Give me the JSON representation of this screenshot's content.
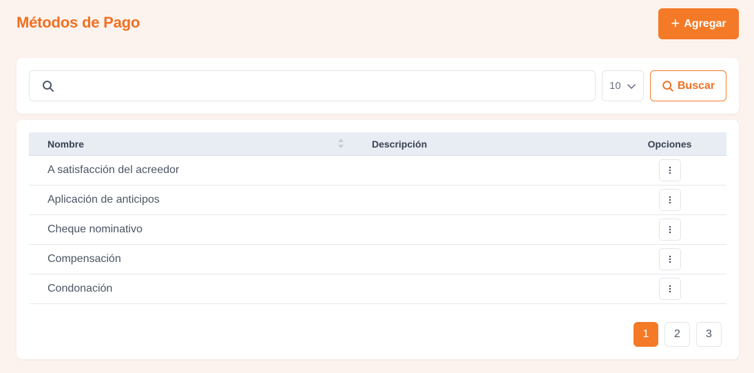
{
  "header": {
    "title": "Métodos de Pago",
    "add_label": "Agregar"
  },
  "search": {
    "value": "",
    "placeholder": "",
    "page_size": "10",
    "button_label": "Buscar"
  },
  "table": {
    "columns": {
      "name": "Nombre",
      "description": "Descripción",
      "options": "Opciones"
    },
    "rows": [
      {
        "name": "A satisfacción del acreedor",
        "description": ""
      },
      {
        "name": "Aplicación de anticipos",
        "description": ""
      },
      {
        "name": "Cheque nominativo",
        "description": ""
      },
      {
        "name": "Compensación",
        "description": ""
      },
      {
        "name": "Condonación",
        "description": ""
      }
    ]
  },
  "pagination": {
    "pages": [
      "1",
      "2",
      "3"
    ],
    "current": "1"
  },
  "colors": {
    "accent": "#f47a27",
    "background": "#fdf3ee"
  },
  "icons": {
    "add": "plus-icon",
    "search": "search-icon",
    "sort": "sort-icon",
    "options": "kebab-icon",
    "select": "chevron-down-icon"
  }
}
